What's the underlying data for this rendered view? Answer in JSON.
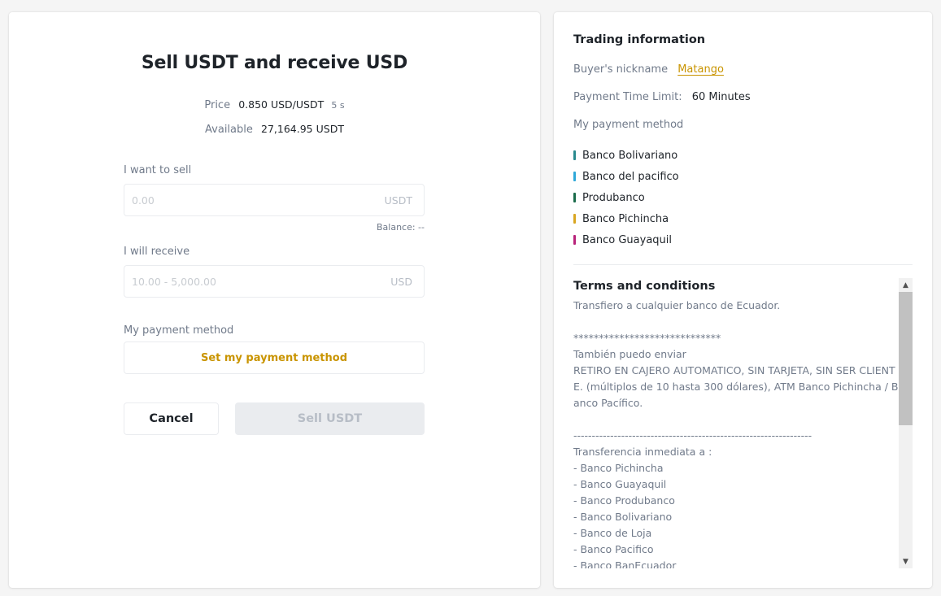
{
  "order_form": {
    "title": "Sell USDT and receive USD",
    "price_label": "Price",
    "price_value": "0.850 USD/USDT",
    "price_timer": "5 s",
    "available_label": "Available",
    "available_value": "27,164.95 USDT",
    "sell_label": "I want to sell",
    "sell_input": {
      "value": "",
      "placeholder": "0.00",
      "unit": "USDT"
    },
    "balance_text": "Balance: --",
    "receive_label": "I will receive",
    "receive_input": {
      "value": "",
      "placeholder": "10.00 - 5,000.00",
      "unit": "USD"
    },
    "payment_method_label": "My payment method",
    "set_payment_method_button": "Set my payment method",
    "cancel_button": "Cancel",
    "sell_button": "Sell USDT"
  },
  "trading_info": {
    "title": "Trading information",
    "buyer_nickname_label": "Buyer's nickname",
    "buyer_nickname": "Matango",
    "payment_time_limit_label": "Payment Time Limit:",
    "payment_time_limit": "60 Minutes",
    "payment_method_label": "My payment method",
    "payment_methods": [
      {
        "name": "Banco Bolivariano",
        "color": "#2a8a8e"
      },
      {
        "name": "Banco del pacifico",
        "color": "#2ea8d8"
      },
      {
        "name": "Produbanco",
        "color": "#1a6b4a"
      },
      {
        "name": "Banco Pichincha",
        "color": "#d9a621"
      },
      {
        "name": "Banco Guayaquil",
        "color": "#b8237a"
      }
    ]
  },
  "terms": {
    "title": "Terms and conditions",
    "text": "Transfiero a cualquier banco de Ecuador.\n\n*****************************\nTambién puedo enviar\nRETIRO EN CAJERO AUTOMATICO, SIN TARJETA, SIN SER CLIENTE. (múltiplos de 10 hasta 300 dólares), ATM Banco Pichincha / Banco Pacífico.\n\n-----------------------------------------------------------------\nTransferencia inmediata a :\n- Banco Pichincha\n- Banco Guayaquil\n- Banco Produbanco\n- Banco Bolivariano\n- Banco de Loja\n- Banco Pacifico\n- Banco BanEcuador"
  },
  "colors": {
    "accent": "#c99400",
    "primary_text": "#1e2329",
    "secondary_text": "#707a8a",
    "border": "#eaecef"
  }
}
